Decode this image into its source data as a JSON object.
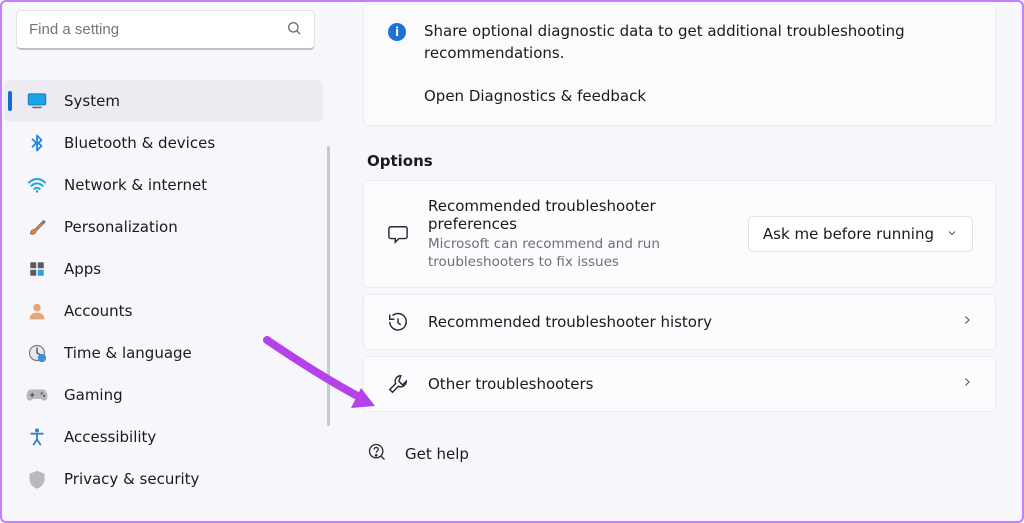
{
  "search": {
    "placeholder": "Find a setting"
  },
  "nav": [
    {
      "label": "System",
      "active": true
    },
    {
      "label": "Bluetooth & devices",
      "active": false
    },
    {
      "label": "Network & internet",
      "active": false
    },
    {
      "label": "Personalization",
      "active": false
    },
    {
      "label": "Apps",
      "active": false
    },
    {
      "label": "Accounts",
      "active": false
    },
    {
      "label": "Time & language",
      "active": false
    },
    {
      "label": "Gaming",
      "active": false
    },
    {
      "label": "Accessibility",
      "active": false
    },
    {
      "label": "Privacy & security",
      "active": false
    }
  ],
  "banner": {
    "text": "Share optional diagnostic data to get additional troubleshooting recommendations.",
    "link": "Open Diagnostics & feedback"
  },
  "section_title": "Options",
  "cards": {
    "prefs": {
      "title": "Recommended troubleshooter preferences",
      "sub": "Microsoft can recommend and run troubleshooters to fix issues",
      "select": "Ask me before running"
    },
    "history": {
      "title": "Recommended troubleshooter history"
    },
    "other": {
      "title": "Other troubleshooters"
    }
  },
  "gethelp": "Get help"
}
